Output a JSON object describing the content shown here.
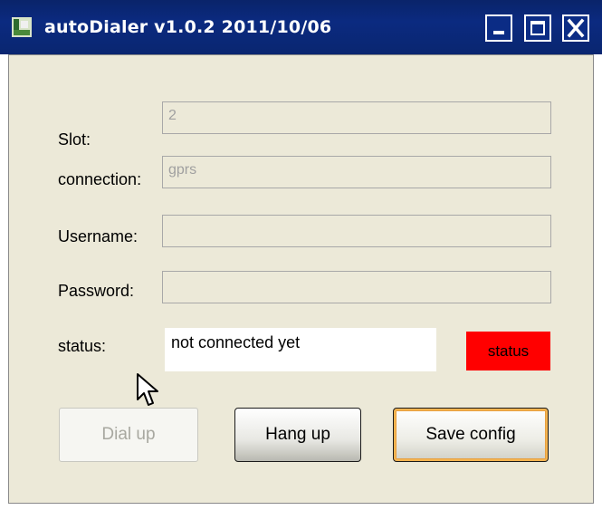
{
  "window": {
    "title": "autoDialer v1.0.2 2011/10/06",
    "controls": [
      "minimize-icon",
      "maximize-icon",
      "close-icon"
    ]
  },
  "form": {
    "slot": {
      "label": "Slot:",
      "value": "2"
    },
    "connection": {
      "label": "connection:",
      "value": "gprs"
    },
    "username": {
      "label": "Username:",
      "value": ""
    },
    "password": {
      "label": "Password:",
      "value": ""
    },
    "status": {
      "label": "status:",
      "text": "not connected yet",
      "indicator": "status",
      "indicator_color": "#ff0000"
    }
  },
  "buttons": {
    "dial_up": "Dial up",
    "hang_up": "Hang up",
    "save_config": "Save config"
  }
}
